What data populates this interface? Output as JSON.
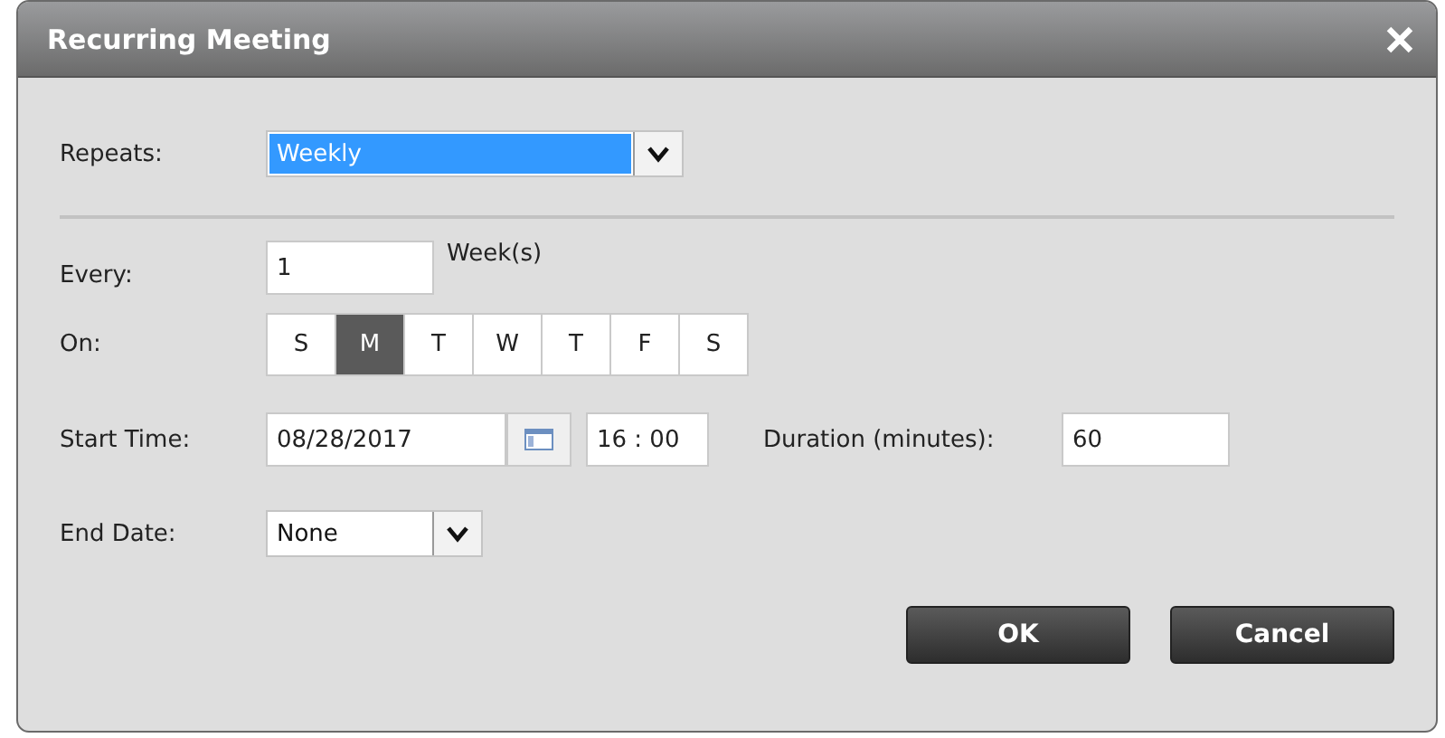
{
  "window": {
    "title": "Recurring Meeting"
  },
  "repeats": {
    "label": "Repeats:",
    "value": "Weekly",
    "focused": true
  },
  "every": {
    "label": "Every:",
    "value": "1",
    "unit": "Week(s)"
  },
  "on": {
    "label": "On:",
    "days": [
      {
        "label": "S",
        "selected": false
      },
      {
        "label": "M",
        "selected": true
      },
      {
        "label": "T",
        "selected": false
      },
      {
        "label": "W",
        "selected": false
      },
      {
        "label": "T",
        "selected": false
      },
      {
        "label": "F",
        "selected": false
      },
      {
        "label": "S",
        "selected": false
      }
    ]
  },
  "start_time": {
    "label": "Start Time:",
    "date": "08/28/2017",
    "time": "16 : 00"
  },
  "duration": {
    "label": "Duration (minutes):",
    "value": "60"
  },
  "end_date": {
    "label": "End Date:",
    "value": "None",
    "focused": false
  },
  "buttons": [
    {
      "label": "OK"
    },
    {
      "label": "Cancel"
    }
  ]
}
